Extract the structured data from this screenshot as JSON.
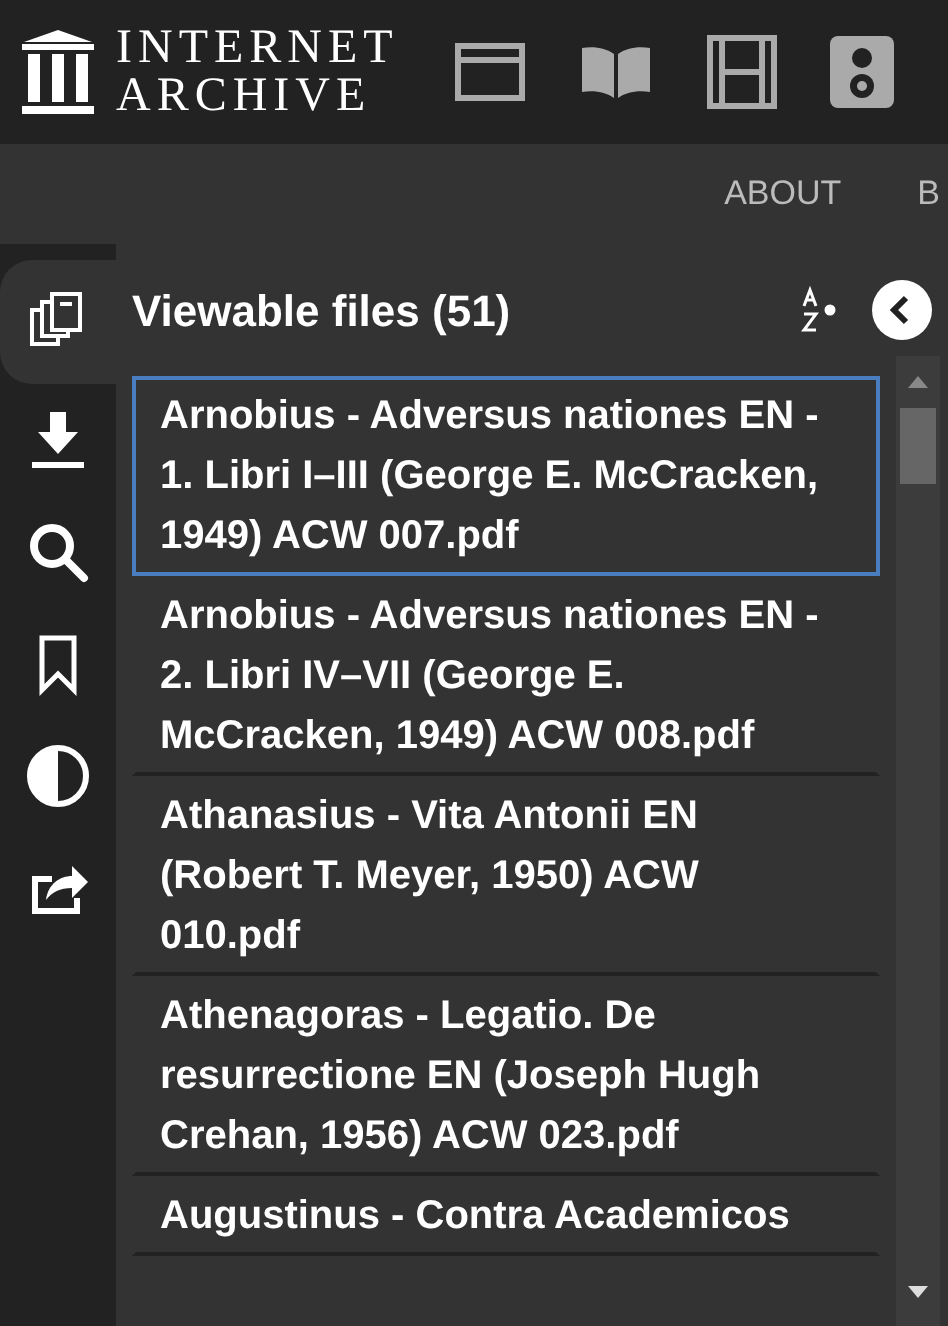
{
  "logo": {
    "line_1": "INTERNET",
    "line_2": "ARCHIVE"
  },
  "nav": [
    "ABOUT",
    "B"
  ],
  "side_tabs": [
    {
      "kind": "files",
      "selected": true
    },
    {
      "kind": "download",
      "selected": false
    },
    {
      "kind": "search",
      "selected": false
    },
    {
      "kind": "bookmark",
      "selected": false
    },
    {
      "kind": "contrast",
      "selected": false
    },
    {
      "kind": "share",
      "selected": false
    }
  ],
  "panel": {
    "title": "Viewable files (51)"
  },
  "files": [
    {
      "name": "Arnobius - Adversus nationes EN - 1. Libri I–III (George E. McCracken, 1949) ACW 007.pdf",
      "selected": true
    },
    {
      "name": "Arnobius - Adversus nationes EN - 2. Libri IV–VII (George E. McCracken, 1949) ACW 008.pdf",
      "selected": false
    },
    {
      "name": "Athanasius - Vita Antonii EN (Robert T. Meyer, 1950) ACW 010.pdf",
      "selected": false
    },
    {
      "name": "Athenagoras - Legatio. De resurrectione EN (Joseph Hugh Crehan, 1956) ACW 023.pdf",
      "selected": false
    },
    {
      "name": "Augustinus - Contra Academicos",
      "selected": false
    }
  ]
}
